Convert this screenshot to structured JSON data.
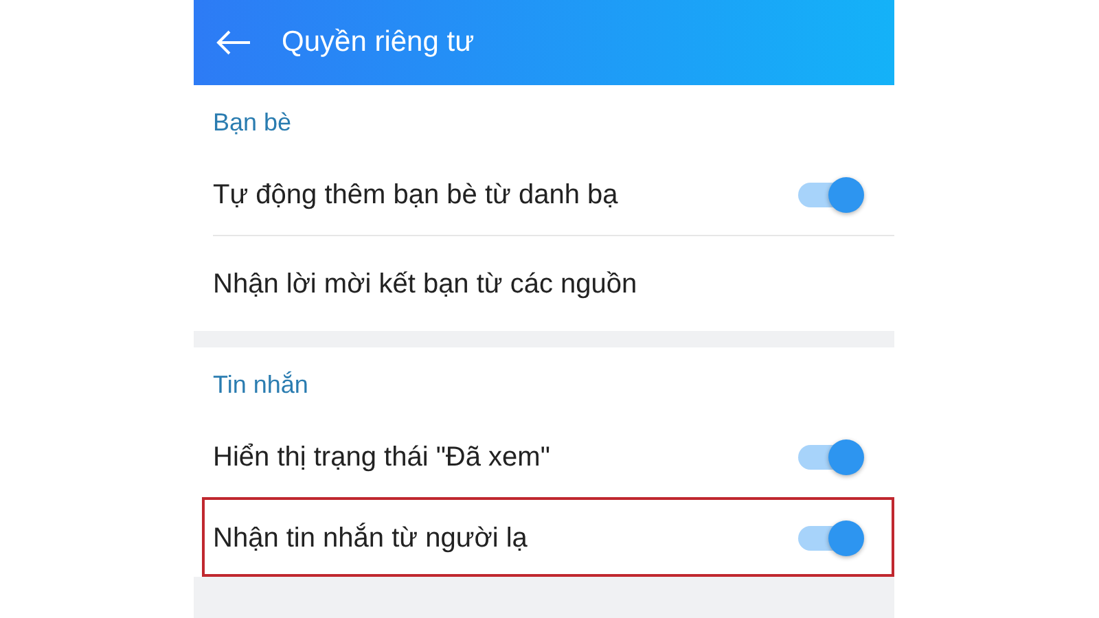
{
  "header": {
    "title": "Quyền riêng tư"
  },
  "sections": [
    {
      "title": "Bạn bè",
      "items": [
        {
          "kind": "toggle",
          "label": "Tự động thêm bạn bè từ danh bạ",
          "on": true,
          "highlighted": false
        },
        {
          "kind": "link",
          "label": "Nhận lời mời kết bạn từ các nguồn",
          "highlighted": false
        }
      ]
    },
    {
      "title": "Tin nhắn",
      "items": [
        {
          "kind": "toggle",
          "label": "Hiển thị trạng thái \"Đã xem\"",
          "on": true,
          "highlighted": false
        },
        {
          "kind": "toggle",
          "label": "Nhận tin nhắn từ người lạ",
          "on": true,
          "highlighted": true
        }
      ]
    }
  ]
}
